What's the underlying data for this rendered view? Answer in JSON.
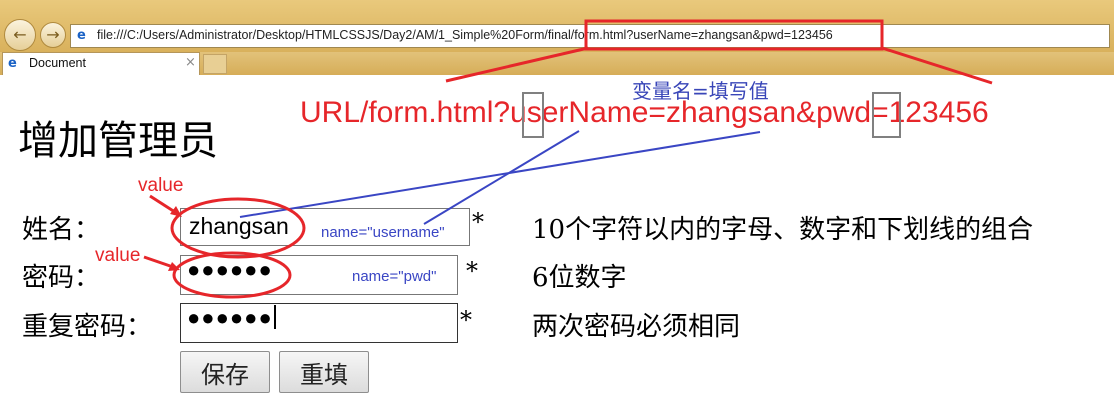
{
  "browser": {
    "url": "file:///C:/Users/Administrator/Desktop/HTMLCSSJS/Day2/AM/1_Simple%20Form/final/form.html?userName=zhangsan&pwd=123456",
    "tab_title": "Document",
    "tab_close": "×",
    "back_icon": "back-arrow-icon",
    "forward_icon": "forward-arrow-icon"
  },
  "page": {
    "title": "增加管理员",
    "fields": [
      {
        "label": "姓名：",
        "value": "zhangsan",
        "required": "*",
        "hint": "10个字符以内的字母、数字和下划线的组合"
      },
      {
        "label": "密码：",
        "value": "●●●●●●",
        "required": "*",
        "hint": "6位数字"
      },
      {
        "label": "重复密码：",
        "value": "●●●●●●",
        "required": "*",
        "hint": "两次密码必须相同"
      }
    ],
    "buttons": {
      "save": "保存",
      "reset": "重填"
    }
  },
  "annotations": {
    "url_example": "URL/form.html?userName=zhangsan&pwd=123456",
    "var_rule": "变量名=填写值",
    "name_username": "name=\"username\"",
    "name_pwd": "name=\"pwd\"",
    "value_label": "value",
    "colors": {
      "red": "#e6262a",
      "blue": "#3a46c4",
      "gray": "#888888"
    }
  }
}
